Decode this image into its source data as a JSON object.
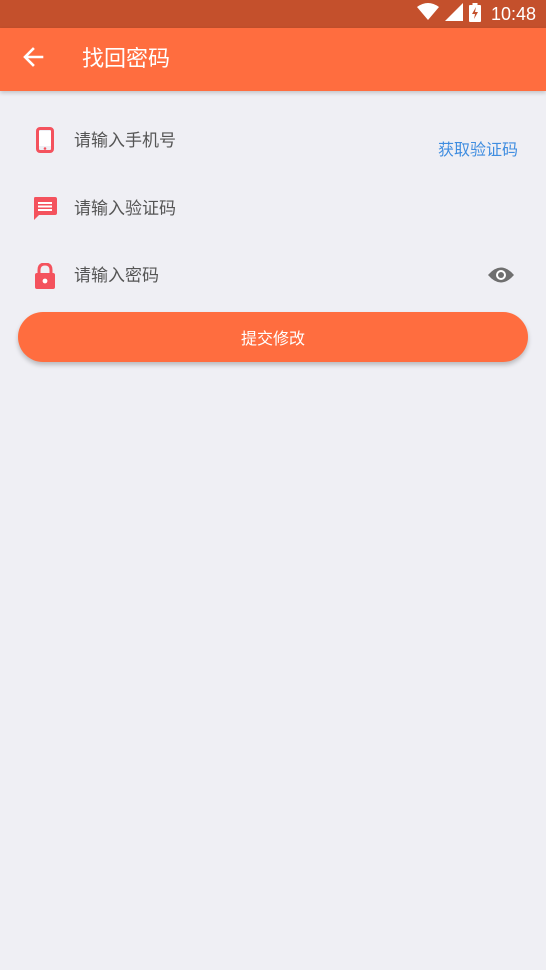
{
  "status_bar": {
    "time": "10:48",
    "icons": [
      "wifi-icon",
      "signal-icon",
      "battery-charging-icon"
    ]
  },
  "app_bar": {
    "title": "找回密码",
    "back_icon": "arrow-left-icon"
  },
  "form": {
    "phone": {
      "icon": "phone-icon",
      "placeholder": "请输入手机号",
      "value": ""
    },
    "get_code_label": "获取验证码",
    "code": {
      "icon": "message-icon",
      "placeholder": "请输入验证码",
      "value": ""
    },
    "password": {
      "icon": "lock-icon",
      "placeholder": "请输入密码",
      "value": "",
      "toggle_icon": "eye-icon"
    },
    "submit_label": "提交修改"
  },
  "colors": {
    "status_bar": "#c4502c",
    "accent": "#ff6d3f",
    "icon_red": "#f4525d",
    "link_blue": "#3f8de0",
    "background": "#efeff4"
  }
}
